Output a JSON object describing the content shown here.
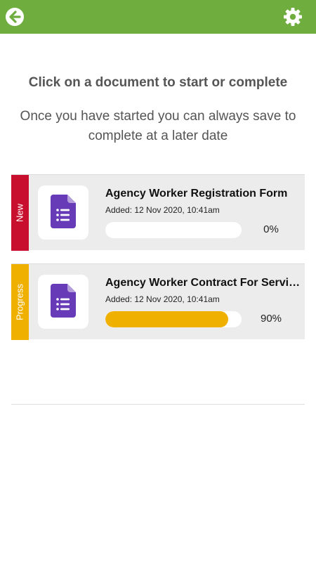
{
  "header": {
    "bar_color": "#6fad3f",
    "back_icon": "arrow-left-circle",
    "settings_icon": "gear"
  },
  "intro": {
    "headline": "Click on a document to start or complete",
    "subline": "Once you have started you can always save to complete at a later date"
  },
  "documents": [
    {
      "status": "New",
      "status_color": "#c8102e",
      "icon": "google-forms-document",
      "title": "Agency Worker Registration Form",
      "added": "Added: 12 Nov 2020, 10:41am",
      "progress": 0,
      "progress_label": "0%"
    },
    {
      "status": "Progress",
      "status_color": "#f0b000",
      "icon": "google-forms-document",
      "title": "Agency Worker Contract For Services",
      "added": "Added: 12 Nov 2020, 10:41am",
      "progress": 0.9,
      "progress_label": "90%"
    }
  ]
}
